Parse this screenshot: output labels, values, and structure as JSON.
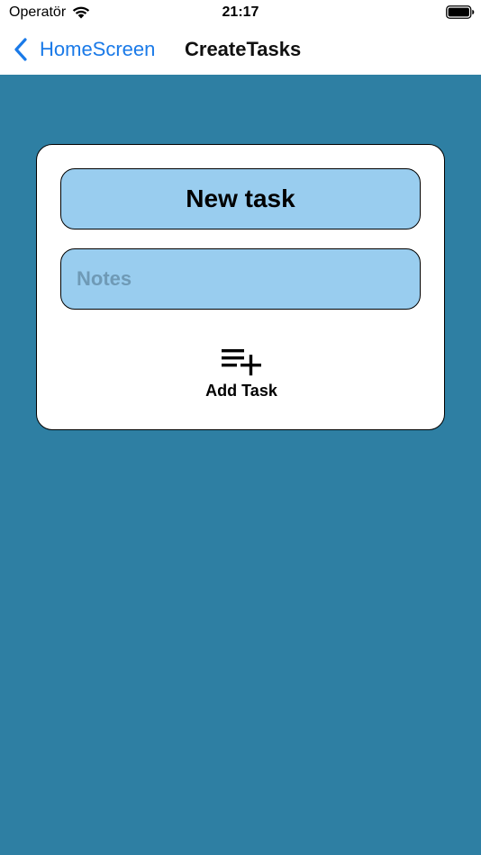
{
  "status_bar": {
    "carrier": "Operatör",
    "time": "21:17"
  },
  "nav": {
    "back_label": "HomeScreen",
    "title": "CreateTasks"
  },
  "form": {
    "title_value": "New task",
    "notes_placeholder": "Notes",
    "add_button_label": "Add Task"
  },
  "icons": {
    "back": "chevron-left-icon",
    "add": "playlist-add-icon",
    "wifi": "wifi-icon",
    "battery": "battery-icon"
  },
  "colors": {
    "background": "#2e7fa3",
    "field_fill": "#99cdef",
    "link_blue": "#1a7ae8"
  }
}
